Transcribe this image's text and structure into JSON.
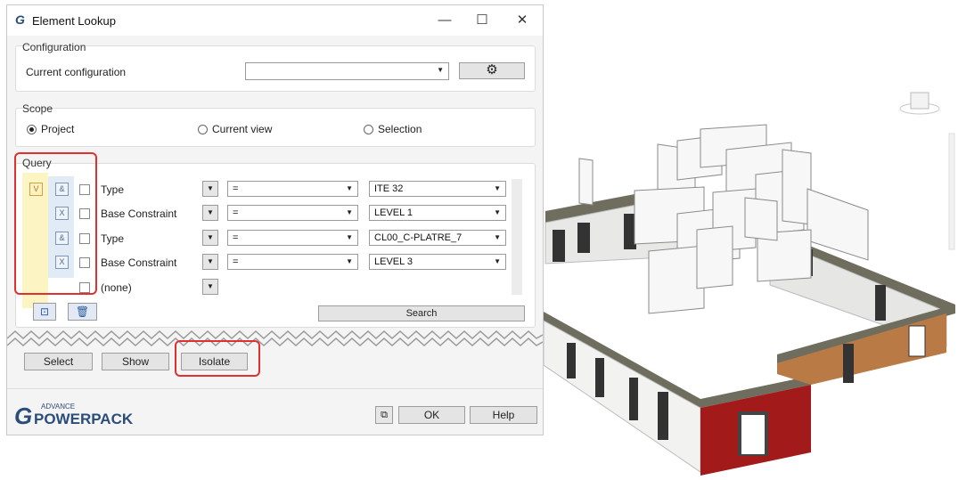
{
  "window": {
    "title": "Element Lookup",
    "minimize": "—",
    "maximize": "☐",
    "close": "✕"
  },
  "configuration": {
    "group_label": "Configuration",
    "current_label": "Current configuration",
    "current_value": ""
  },
  "scope": {
    "group_label": "Scope",
    "options": [
      {
        "label": "Project",
        "selected": true
      },
      {
        "label": "Current view",
        "selected": false
      },
      {
        "label": "Selection",
        "selected": false
      }
    ]
  },
  "query": {
    "group_label": "Query",
    "rows": [
      {
        "op_left": "V",
        "op_right": "&",
        "parameter": "Type",
        "operator": "=",
        "value": "ITE 32"
      },
      {
        "op_left": "",
        "op_right": "X",
        "parameter": "Base Constraint",
        "operator": "=",
        "value": "LEVEL 1"
      },
      {
        "op_left": "",
        "op_right": "&",
        "parameter": "Type",
        "operator": "=",
        "value": "CL00_C-PLATRE_7"
      },
      {
        "op_left": "",
        "op_right": "X",
        "parameter": "Base Constraint",
        "operator": "=",
        "value": "LEVEL 3"
      },
      {
        "op_left": "",
        "op_right": "",
        "parameter": "(none)",
        "operator": "",
        "value": ""
      }
    ],
    "search_label": "Search"
  },
  "actions": {
    "select": "Select",
    "show": "Show",
    "isolate": "Isolate"
  },
  "footer": {
    "brand_small": "ADVANCE",
    "brand_large": "POWERPACK",
    "ok": "OK",
    "help": "Help"
  },
  "colors": {
    "highlight": "#e03030",
    "query_yellow": "#fdf4c4",
    "wall_red": "#a31a1a",
    "wall_orange": "#b97a45"
  }
}
